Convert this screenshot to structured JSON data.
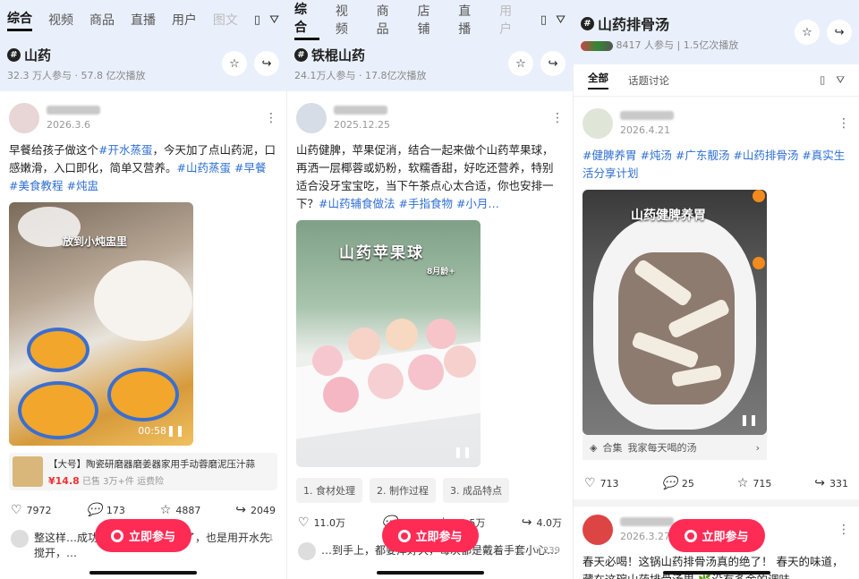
{
  "panels": [
    {
      "tabs": [
        "综合",
        "视频",
        "商品",
        "直播",
        "用户",
        "图文"
      ],
      "topic": {
        "title": "山药",
        "stats": "32.3 万人参与 · 57.8 亿次播放"
      },
      "post": {
        "date": "2026.3.6",
        "text_plain_a": "早餐给孩子做这个",
        "tag_a": "#开水蒸蛋",
        "text_plain_b": "，今天加了点山药泥，口感嫩滑，入口即化，简单又营养。",
        "tag_b": "#山药蒸蛋",
        "tag_c": "#早餐",
        "tag_d": "#美食教程",
        "tag_e": "#炖盅",
        "caption": "放到小炖盅里",
        "duration": "00:58",
        "product_title": "【大号】陶瓷研磨器磨姜器家用手动蓉磨泥压汁蒜",
        "product_price": "¥14.8",
        "product_meta": "已售 3万+件  运费险",
        "likes": "7972",
        "comments": "173",
        "favorites": "4887",
        "shares": "2049"
      },
      "comment": {
        "text": "整这样…成功过，泡沫也舀出去了，也是用开水先搅开，…",
        "likes": "41"
      }
    },
    {
      "tabs": [
        "综合",
        "视频",
        "商品",
        "店铺",
        "直播",
        "用户"
      ],
      "topic": {
        "title": "铁棍山药",
        "stats": "24.1万人参与 · 17.8亿次播放"
      },
      "post": {
        "date": "2025.12.25",
        "text_plain": "山药健脾，苹果促消，结合一起来做个山药苹果球，再洒一层椰蓉或奶粉，软糯香甜，好吃还营养，特别适合没牙宝宝吃，当下午茶点心太合适，你也安排一下？",
        "tag_a": "#山药辅食做法",
        "tag_b": "#手指食物",
        "tag_c": "#小月…",
        "caption": "山药苹果球",
        "caption_sub": "8月龄+",
        "chips": [
          "1. 食材处理",
          "2. 制作过程",
          "3. 成品特点"
        ],
        "likes": "11.0万",
        "comments": "",
        "favorites": "11.5万",
        "shares": "4.0万"
      },
      "comment": {
        "text": "…到手上，都要痒好久，每次都是戴着手套小心…",
        "likes": "239"
      }
    },
    {
      "topic": {
        "title": "山药排骨汤",
        "stats_a": "8417 人参与",
        "stats_b": "1.5亿次播放"
      },
      "subtabs": [
        "全部",
        "话题讨论"
      ],
      "post": {
        "date": "2026.4.21",
        "tags": "#健脾养胃 #炖汤 #广东靓汤 #山药排骨汤 #真实生活分享计划",
        "caption": "山药健脾养胃",
        "collection_label": "合集",
        "collection_name": "我家每天喝的汤",
        "likes": "713",
        "comments": "25",
        "favorites": "715",
        "shares": "331"
      },
      "post2": {
        "date": "2026.3.27",
        "text": "春天必喝！这锅山药排骨汤真的绝了！ 春天的味道，藏在这碗山药排骨汤里 🌿没有多余的调味"
      }
    }
  ],
  "join_label": "立即参与",
  "colors": {
    "accent": "#fe2c55",
    "tag": "#2f6fd1",
    "header_bg": "#eaf0fb"
  }
}
